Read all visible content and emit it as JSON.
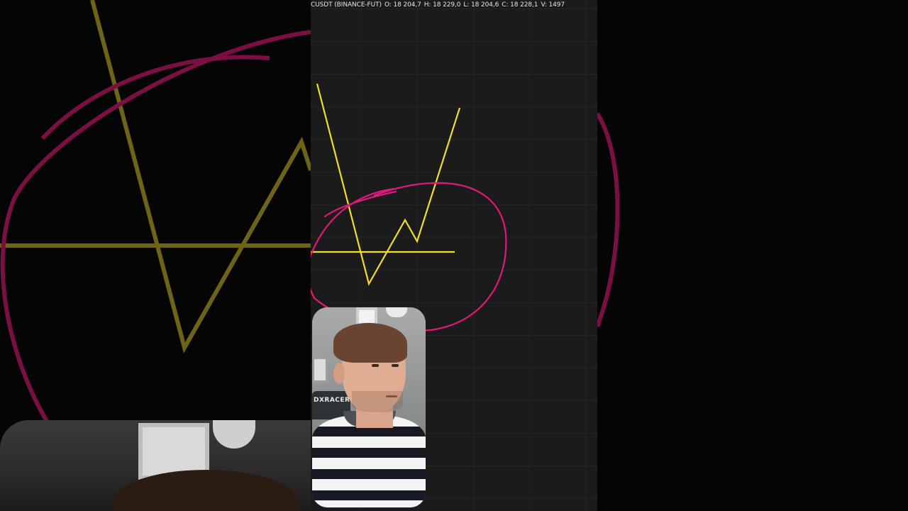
{
  "chart": {
    "ohlc_header": {
      "symbol": "CUSDT (BINANCE-FUT)",
      "open": "O: 18 204,7",
      "high": "H: 18 229,0",
      "low": "L: 18 204,6",
      "close": "C: 18 228,1",
      "volume": "V: 1497"
    },
    "drawing_colors": {
      "yellow_line": "#f2dd2a",
      "magenta_circle": "#e0197a"
    }
  },
  "webcam": {
    "chair_brand": "DXRACER"
  },
  "colors": {
    "background": "#000000",
    "chart_background": "#1b1b1b",
    "header_text": "#e6e6e6"
  }
}
